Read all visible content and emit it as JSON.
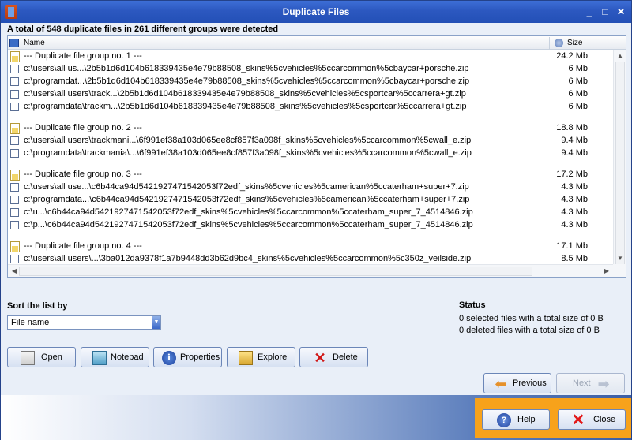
{
  "window": {
    "title": "Duplicate Files"
  },
  "header": {
    "summary": "A total of 548 duplicate files in 261 different groups were detected"
  },
  "list": {
    "columns": {
      "name": "Name",
      "size": "Size"
    },
    "rows": [
      {
        "kind": "group",
        "text": "--- Duplicate file group no. 1 ---",
        "size": "24.2 Mb"
      },
      {
        "kind": "file",
        "text": "c:\\users\\all us...\\2b5b1d6d104b618339435e4e79b88508_skins%5cvehicles%5ccarcommon%5cbaycar+porsche.zip",
        "size": "6 Mb"
      },
      {
        "kind": "file",
        "text": "c:\\programdat...\\2b5b1d6d104b618339435e4e79b88508_skins%5cvehicles%5ccarcommon%5cbaycar+porsche.zip",
        "size": "6 Mb"
      },
      {
        "kind": "file",
        "text": "c:\\users\\all users\\track...\\2b5b1d6d104b618339435e4e79b88508_skins%5cvehicles%5csportcar%5ccarrera+gt.zip",
        "size": "6 Mb"
      },
      {
        "kind": "file",
        "text": "c:\\programdata\\trackm...\\2b5b1d6d104b618339435e4e79b88508_skins%5cvehicles%5csportcar%5ccarrera+gt.zip",
        "size": "6 Mb"
      },
      {
        "kind": "gap"
      },
      {
        "kind": "group",
        "text": "--- Duplicate file group no. 2 ---",
        "size": "18.8 Mb"
      },
      {
        "kind": "file",
        "text": "c:\\users\\all users\\trackmani...\\6f991ef38a103d065ee8cf857f3a098f_skins%5cvehicles%5ccarcommon%5cwall_e.zip",
        "size": "9.4 Mb"
      },
      {
        "kind": "file",
        "text": "c:\\programdata\\trackmania\\...\\6f991ef38a103d065ee8cf857f3a098f_skins%5cvehicles%5ccarcommon%5cwall_e.zip",
        "size": "9.4 Mb"
      },
      {
        "kind": "gap"
      },
      {
        "kind": "group",
        "text": "--- Duplicate file group no. 3 ---",
        "size": "17.2 Mb"
      },
      {
        "kind": "file",
        "text": "c:\\users\\all use...\\c6b44ca94d5421927471542053f72edf_skins%5cvehicles%5camerican%5ccaterham+super+7.zip",
        "size": "4.3 Mb"
      },
      {
        "kind": "file",
        "text": "c:\\programdata...\\c6b44ca94d5421927471542053f72edf_skins%5cvehicles%5camerican%5ccaterham+super+7.zip",
        "size": "4.3 Mb"
      },
      {
        "kind": "file",
        "text": "c:\\u...\\c6b44ca94d5421927471542053f72edf_skins%5cvehicles%5ccarcommon%5ccaterham_super_7_4514846.zip",
        "size": "4.3 Mb"
      },
      {
        "kind": "file",
        "text": "c:\\p...\\c6b44ca94d5421927471542053f72edf_skins%5cvehicles%5ccarcommon%5ccaterham_super_7_4514846.zip",
        "size": "4.3 Mb"
      },
      {
        "kind": "gap"
      },
      {
        "kind": "group",
        "text": "--- Duplicate file group no. 4 ---",
        "size": "17.1 Mb"
      },
      {
        "kind": "file",
        "text": "c:\\users\\all users\\...\\3ba012da9378f1a7b9448dd3b62d9bc4_skins%5cvehicles%5ccarcommon%5c350z_veilside.zip",
        "size": "8.5 Mb"
      }
    ]
  },
  "sort": {
    "label": "Sort the list by",
    "selected": "File name"
  },
  "status": {
    "label": "Status",
    "selected": "0 selected files with a total size of 0 B",
    "deleted": "0 deleted files with a total size of 0 B"
  },
  "actions": {
    "open": "Open",
    "notepad": "Notepad",
    "properties": "Properties",
    "explore": "Explore",
    "delete": "Delete"
  },
  "nav": {
    "previous": "Previous",
    "next": "Next"
  },
  "footer": {
    "help": "Help",
    "close": "Close"
  },
  "icons": [
    "app-icon",
    "minimize-icon",
    "maximize-icon",
    "close-window-icon",
    "column-icon",
    "size-sort-icon",
    "group-file-icon",
    "open-icon",
    "notepad-icon",
    "properties-icon",
    "explore-icon",
    "delete-icon",
    "previous-arrow-icon",
    "next-arrow-icon",
    "help-icon",
    "close-icon"
  ]
}
